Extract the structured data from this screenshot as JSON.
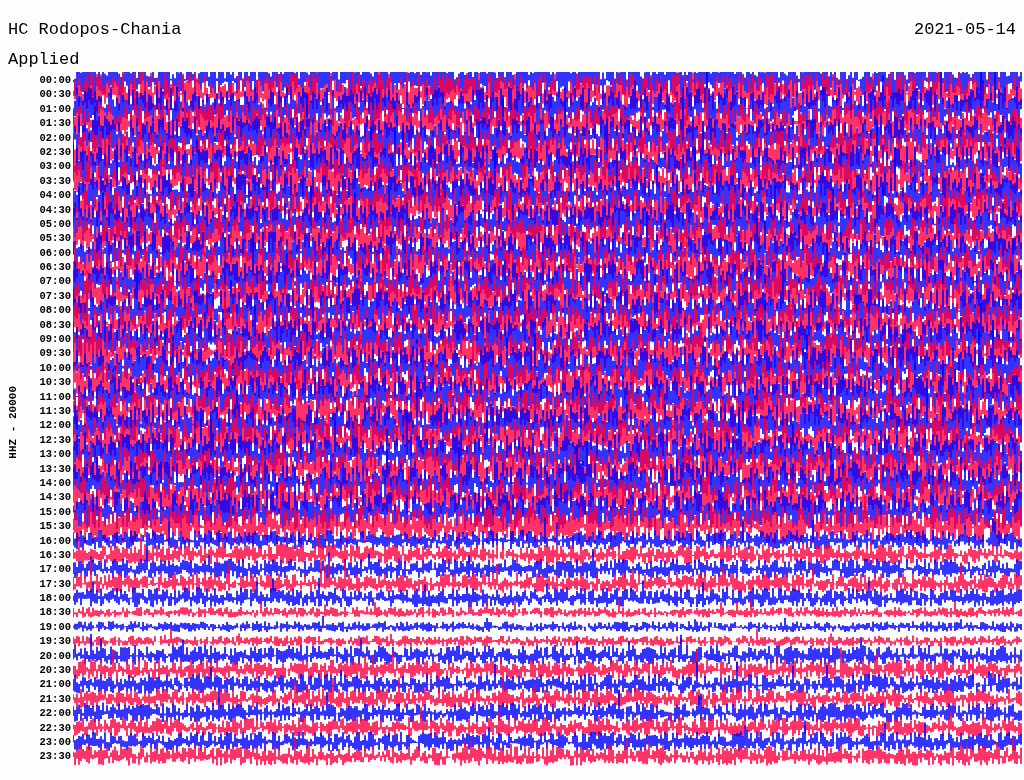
{
  "header": {
    "station": "HC Rodopos-Chania",
    "date": "2021-05-14",
    "subtitle": "Applied"
  },
  "axis_label": "HHZ - 20000",
  "times": [
    "00:00",
    "00:30",
    "01:00",
    "01:30",
    "02:00",
    "02:30",
    "03:00",
    "03:30",
    "04:00",
    "04:30",
    "05:00",
    "05:30",
    "06:00",
    "06:30",
    "07:00",
    "07:30",
    "08:00",
    "08:30",
    "09:00",
    "09:30",
    "10:00",
    "10:30",
    "11:00",
    "11:30",
    "12:00",
    "12:30",
    "13:00",
    "13:30",
    "14:00",
    "14:30",
    "15:00",
    "15:30",
    "16:00",
    "16:30",
    "17:00",
    "17:30",
    "18:00",
    "18:30",
    "19:00",
    "19:30",
    "20:00",
    "20:30",
    "21:00",
    "21:30",
    "22:00",
    "22:30",
    "23:00",
    "23:30"
  ]
}
